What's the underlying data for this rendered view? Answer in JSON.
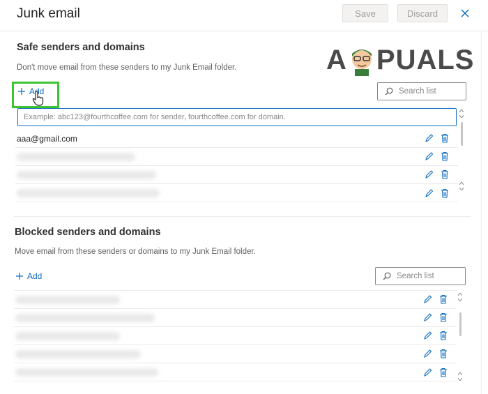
{
  "header": {
    "title": "Junk email",
    "save_label": "Save",
    "discard_label": "Discard"
  },
  "safe": {
    "heading": "Safe senders and domains",
    "description": "Don't move email from these senders to my Junk Email folder.",
    "add_label": "Add",
    "search_placeholder": "Search list",
    "input_placeholder": "Example: abc123@fourthcoffee.com for sender, fourthcoffee.com for domain.",
    "entries": [
      "aaa@gmail.com"
    ]
  },
  "blocked": {
    "heading": "Blocked senders and domains",
    "description": "Move email from these senders or domains to my Junk Email folder.",
    "add_label": "Add",
    "search_placeholder": "Search list"
  },
  "watermark": "APPUALS",
  "colors": {
    "accent": "#0f6cbd",
    "highlight": "#3cc531"
  }
}
